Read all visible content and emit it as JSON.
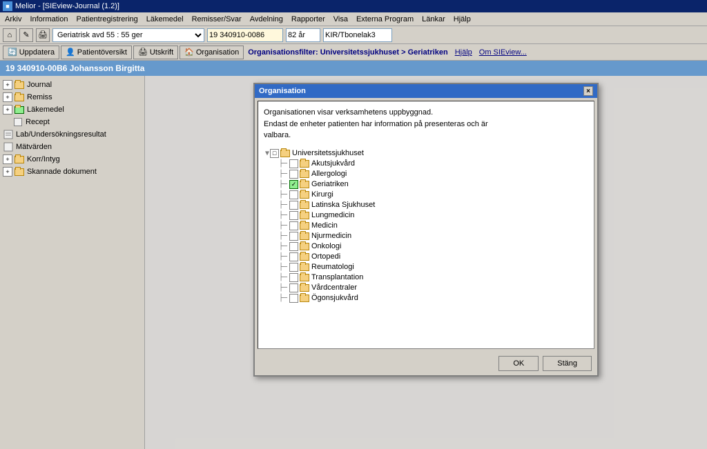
{
  "titlebar": {
    "text": "Melior - [SIEview-Journal (1.2)]",
    "icon": "M"
  },
  "menubar": {
    "items": [
      "Arkiv",
      "Information",
      "Patientregistrering",
      "Läkemedel",
      "Remisser/Svar",
      "Avdelning",
      "Rapporter",
      "Visa",
      "Externa Program",
      "Länkar",
      "Hjälp"
    ]
  },
  "toolbar": {
    "dropdown_value": "Geriatrisk avd 55 : 55 ger",
    "patient_id": "19 340910-0086",
    "age": "82 år",
    "user": "KIR/Tbonelak3"
  },
  "actionbar": {
    "update_btn": "Uppdatera",
    "patient_btn": "Patientöversikt",
    "print_btn": "Utskrift",
    "org_btn": "Organisation",
    "filter_text": "Organisationsfilter: Universitetssjukhuset > Geriatriken",
    "help_link": "Hjälp",
    "about_link": "Om SIEview..."
  },
  "patient_header": {
    "text": "19 340910-00B6 Johansson Birgitta"
  },
  "sidebar": {
    "items": [
      {
        "label": "Journal",
        "type": "folder",
        "indent": 0,
        "expanded": true
      },
      {
        "label": "Remiss",
        "type": "folder",
        "indent": 0,
        "expanded": true
      },
      {
        "label": "Läkemedel",
        "type": "folder",
        "indent": 0,
        "expanded": false
      },
      {
        "label": "Recept",
        "type": "leaf",
        "indent": 1
      },
      {
        "label": "Lab/Undersökningsresultat",
        "type": "leaf",
        "indent": 0
      },
      {
        "label": "Mätvärden",
        "type": "leaf",
        "indent": 0
      },
      {
        "label": "Korr/Intyg",
        "type": "folder",
        "indent": 0,
        "expanded": false
      },
      {
        "label": "Skannade dokument",
        "type": "folder",
        "indent": 0,
        "expanded": false
      }
    ]
  },
  "dialog": {
    "title": "Organisation",
    "close_btn": "×",
    "description_line1": "Organisationen visar verksamhetens uppbyggnad.",
    "description_line2": "Endast de enheter patienten har information på presenteras och är",
    "description_line3": "valbara.",
    "tree": {
      "root": "Universitetssjukhuset",
      "children": [
        {
          "label": "Akutsjukvård",
          "checked": false
        },
        {
          "label": "Allergologi",
          "checked": false
        },
        {
          "label": "Geriatriken",
          "checked": true
        },
        {
          "label": "Kirurgi",
          "checked": false
        },
        {
          "label": "Latinska Sjukhuset",
          "checked": false
        },
        {
          "label": "Lungmedicin",
          "checked": false
        },
        {
          "label": "Medicin",
          "checked": false
        },
        {
          "label": "Njurmedicin",
          "checked": false
        },
        {
          "label": "Onkologi",
          "checked": false
        },
        {
          "label": "Ortopedi",
          "checked": false
        },
        {
          "label": "Reumatologi",
          "checked": false
        },
        {
          "label": "Transplantation",
          "checked": false
        },
        {
          "label": "Vårdcentraler",
          "checked": false
        },
        {
          "label": "Ögonsjukvård",
          "checked": false
        }
      ]
    },
    "ok_btn": "OK",
    "cancel_btn": "Stäng"
  }
}
